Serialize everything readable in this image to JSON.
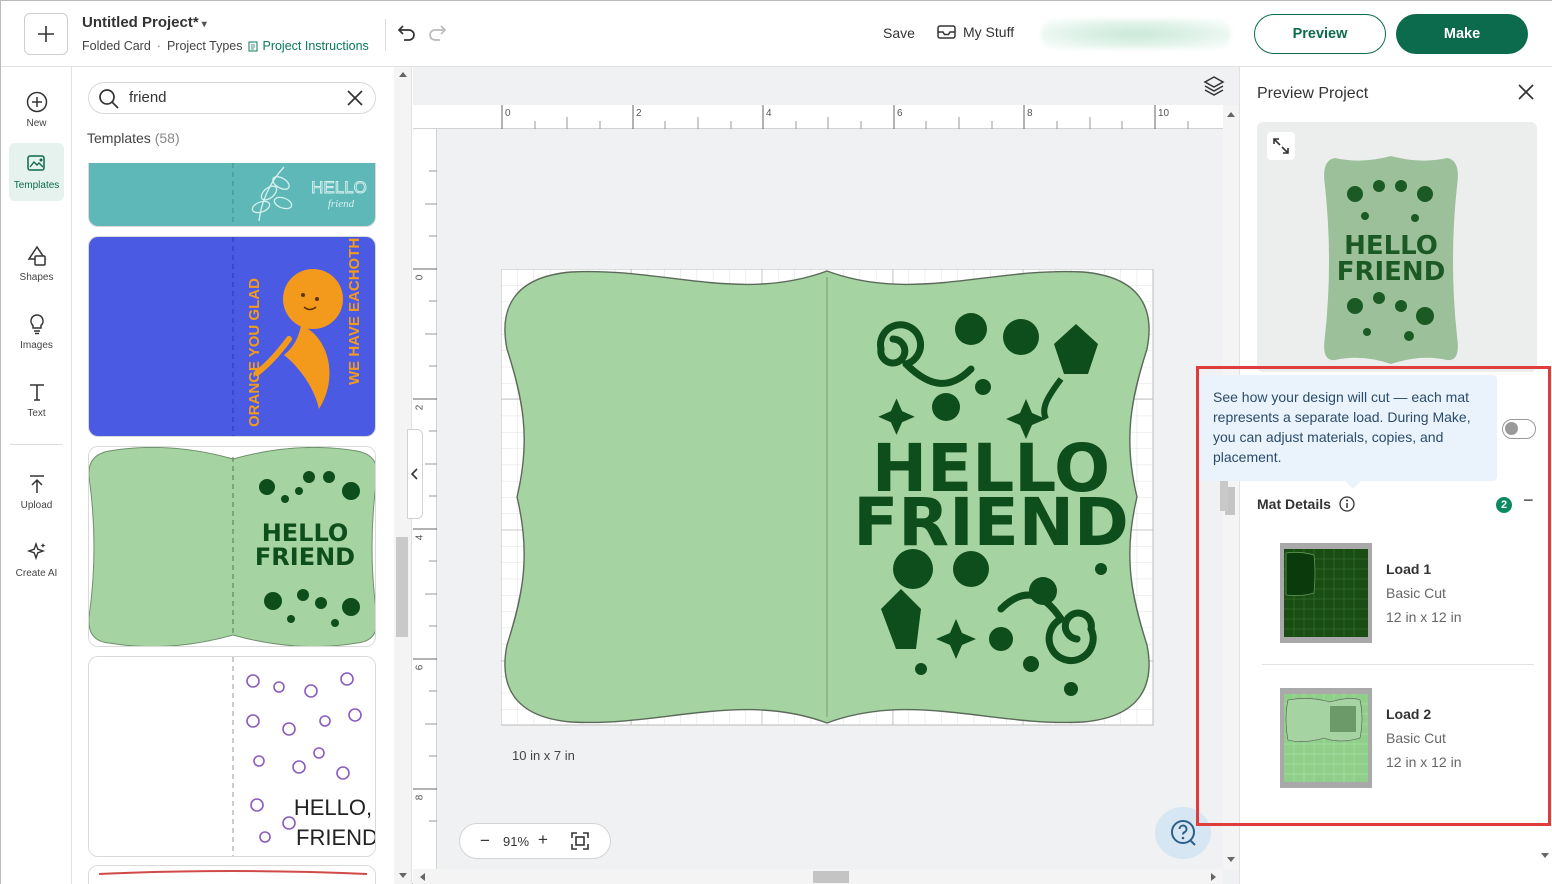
{
  "header": {
    "new_label": "+",
    "project_title": "Untitled Project*",
    "project_type": "Folded Card",
    "project_types_link": "Project Types",
    "project_instructions_link": "Project Instructions",
    "save_label": "Save",
    "mystuff_label": "My Stuff",
    "preview_label": "Preview",
    "make_label": "Make",
    "accent_color": "#0c6b4d"
  },
  "rail": {
    "items": [
      {
        "label": "New",
        "icon": "plus-circle-icon"
      },
      {
        "label": "Templates",
        "icon": "templates-icon"
      },
      {
        "label": "Shapes",
        "icon": "shapes-icon"
      },
      {
        "label": "Images",
        "icon": "lightbulb-icon"
      },
      {
        "label": "Text",
        "icon": "text-icon"
      },
      {
        "label": "Upload",
        "icon": "upload-icon"
      },
      {
        "label": "Create AI",
        "icon": "sparkle-icon"
      }
    ]
  },
  "templates": {
    "search_value": "friend",
    "heading": "Templates",
    "count": "(58)",
    "cards": [
      {
        "lines": [
          "HELLO",
          "friend"
        ],
        "bg": "#5fb8b8"
      },
      {
        "lines": [
          "ORANGE YOU GLAD",
          "WE HAVE EACHOTHER"
        ],
        "bg": "#4b5ae3"
      },
      {
        "lines": [
          "HELLO",
          "FRIEND"
        ],
        "bg": "#a6d3a2"
      },
      {
        "lines": [
          "HELLO,",
          "FRIEND"
        ],
        "bg": "#ffffff"
      }
    ]
  },
  "canvas": {
    "ruler_top": [
      "0",
      "2",
      "4",
      "6",
      "8",
      "10"
    ],
    "ruler_left": [
      "0",
      "2",
      "4",
      "6",
      "8"
    ],
    "card_line1": "HELLO",
    "card_line2": "FRIEND",
    "card_color": "#a6d3a2",
    "ink_color": "#0e4d1c",
    "dimensions": "10 in x 7 in",
    "zoom_minus": "−",
    "zoom_value": "91%",
    "zoom_plus": "+"
  },
  "preview_panel": {
    "title": "Preview Project",
    "preview_line1": "HELLO",
    "preview_line2": "FRIEND",
    "tooltip": "See how your design will cut — each mat represents a separate load. During Make, you can adjust materials, copies, and placement.",
    "mat_details": "Mat Details",
    "mat_count": "2",
    "collapse": "−",
    "loads": [
      {
        "title": "Load 1",
        "cut": "Basic Cut",
        "size": "12 in x 12 in"
      },
      {
        "title": "Load 2",
        "cut": "Basic Cut",
        "size": "12 in x 12 in"
      }
    ]
  }
}
